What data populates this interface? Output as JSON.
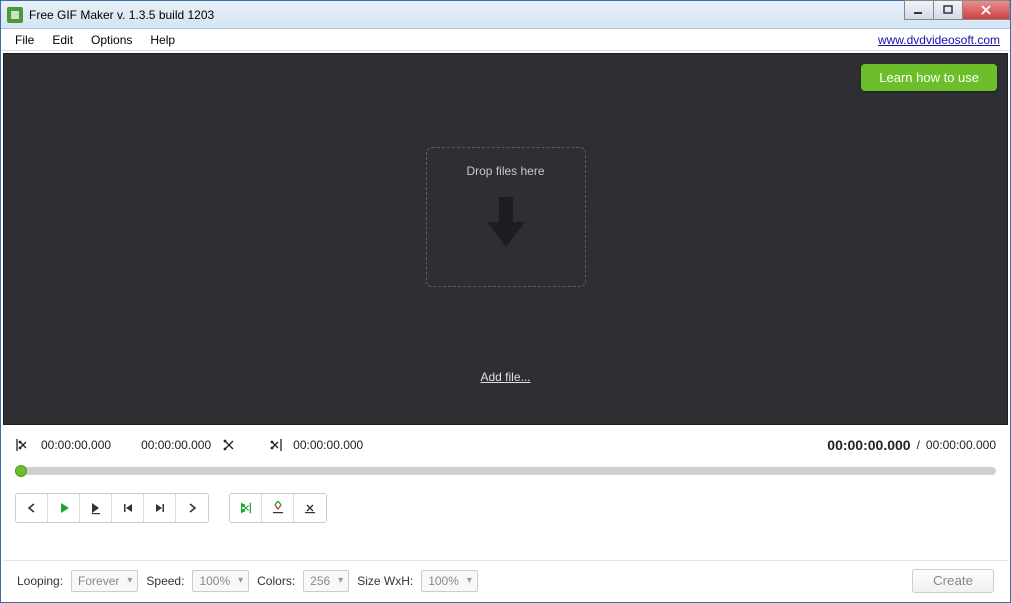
{
  "titlebar": {
    "title": "Free GIF Maker v. 1.3.5 build 1203"
  },
  "menubar": {
    "items": [
      "File",
      "Edit",
      "Options",
      "Help"
    ],
    "link": "www.dvdvideosoft.com"
  },
  "stage": {
    "learn_label": "Learn how to use",
    "drop_text": "Drop files here",
    "addfile_label": "Add file..."
  },
  "timecodes": {
    "mark_in": "00:00:00.000",
    "mark_a": "00:00:00.000",
    "mark_out": "00:00:00.000",
    "current": "00:00:00.000",
    "slash": "/",
    "total": "00:00:00.000"
  },
  "bottombar": {
    "looping_label": "Looping:",
    "looping_value": "Forever",
    "speed_label": "Speed:",
    "speed_value": "100%",
    "colors_label": "Colors:",
    "colors_value": "256",
    "size_label": "Size WxH:",
    "size_value": "100%",
    "create_label": "Create"
  }
}
